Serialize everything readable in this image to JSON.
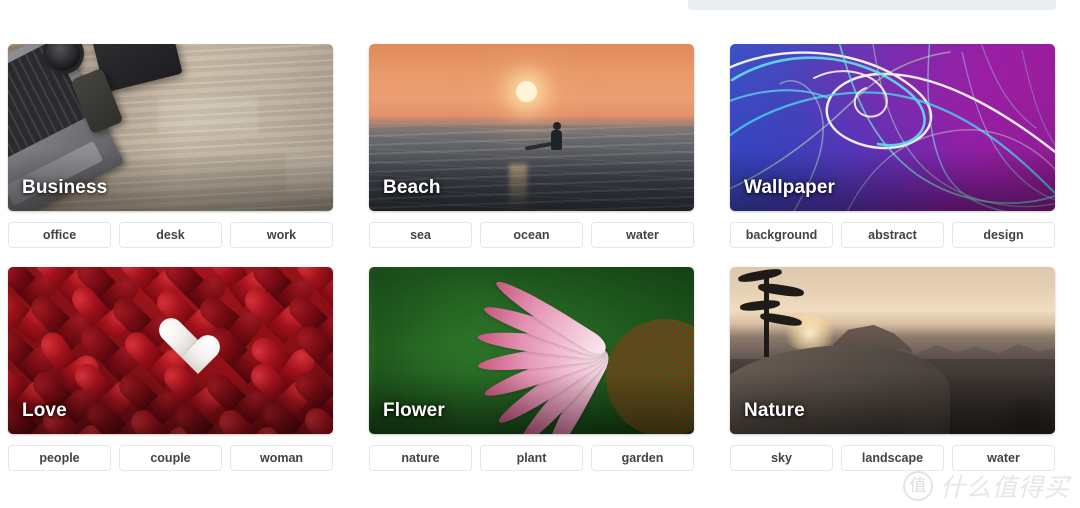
{
  "page": {
    "background_color": "#ffffff",
    "top_bar_color": "#eaedf0"
  },
  "cards": [
    {
      "title": "Business",
      "image_subject": "laptop, camera lens, notebook and phone flat-lay on wooden desk",
      "tags": [
        "office",
        "desk",
        "work"
      ]
    },
    {
      "title": "Beach",
      "image_subject": "surfer silhouette in ocean waves at orange sunset",
      "tags": [
        "sea",
        "ocean",
        "water"
      ]
    },
    {
      "title": "Wallpaper",
      "image_subject": "abstract blue to purple gradient with cyan and white light streaks",
      "tags": [
        "background",
        "abstract",
        "design"
      ]
    },
    {
      "title": "Love",
      "image_subject": "pile of glossy red candy hearts with one white heart",
      "tags": [
        "people",
        "couple",
        "woman"
      ]
    },
    {
      "title": "Flower",
      "image_subject": "pink coneflower petals close-up against green background",
      "tags": [
        "nature",
        "plant",
        "garden"
      ]
    },
    {
      "title": "Nature",
      "image_subject": "mountain valley at sunrise with pine tree and granite rocks",
      "tags": [
        "sky",
        "landscape",
        "water"
      ]
    }
  ],
  "watermark": {
    "logo_glyph": "值",
    "text": "什么值得买"
  }
}
